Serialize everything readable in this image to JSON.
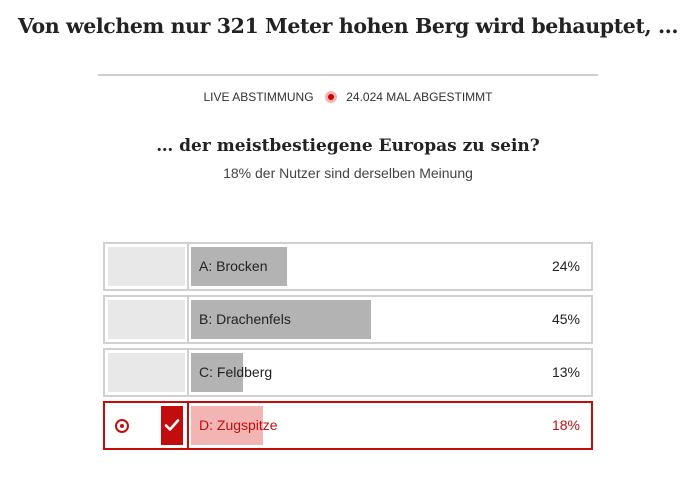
{
  "headline": "Von welchem nur 321 Meter hohen Berg wird behauptet, …",
  "meta": {
    "live_label": "LIVE ABSTIMMUNG",
    "live_icon": "live-dot-icon",
    "votes_label": "24.024 MAL ABGESTIMMT"
  },
  "question": "… der meistbestiegene Europas zu sein?",
  "subline": "18% der Nutzer sind derselben Meinung",
  "colors": {
    "accent": "#c30d0d",
    "bar": "#b3b3b3",
    "bar_selected": "#f3b4b4",
    "border": "#d0d0d0"
  },
  "answers": [
    {
      "label": "A: Brocken",
      "percent_label": "24%",
      "share": 0.24,
      "selected": false
    },
    {
      "label": "B: Drachenfels",
      "percent_label": "45%",
      "share": 0.45,
      "selected": false
    },
    {
      "label": "C: Feldberg",
      "percent_label": "13%",
      "share": 0.13,
      "selected": false
    },
    {
      "label": "D: Zugspitze",
      "percent_label": "18%",
      "share": 0.18,
      "selected": true,
      "icons": [
        "radio-selected-icon",
        "checkmark-icon"
      ]
    }
  ]
}
